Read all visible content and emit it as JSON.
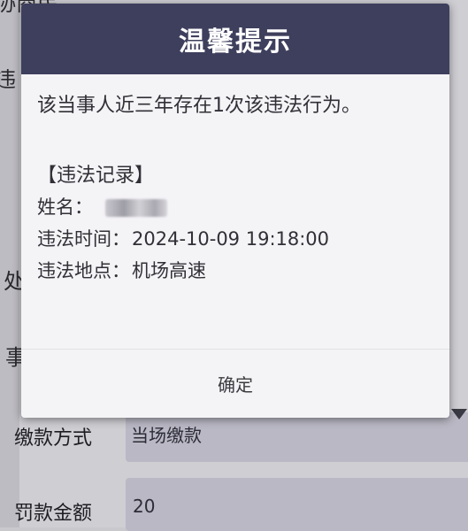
{
  "background": {
    "top_fragment": "协商民",
    "left_fragment_1": "违",
    "left_fragment_2": "处",
    "left_fragment_3": "事",
    "payment_method_label": "缴款方式",
    "payment_method_value": "当场缴款",
    "fine_amount_label": "罚款金额",
    "fine_amount_value": "20"
  },
  "dialog": {
    "title": "温馨提示",
    "message": "该当事人近三年存在1次该违法行为。",
    "record_title": "【违法记录】",
    "name_label": "姓名：",
    "time_label": "违法时间：",
    "time_value": "2024-10-09 19:18:00",
    "place_label": "违法地点：",
    "place_value": "机场高速",
    "confirm_label": "确定"
  },
  "colors": {
    "header_bg": "#3e3f5d",
    "dialog_bg": "#f4f3f6",
    "screen_bg": "#cfced3"
  }
}
